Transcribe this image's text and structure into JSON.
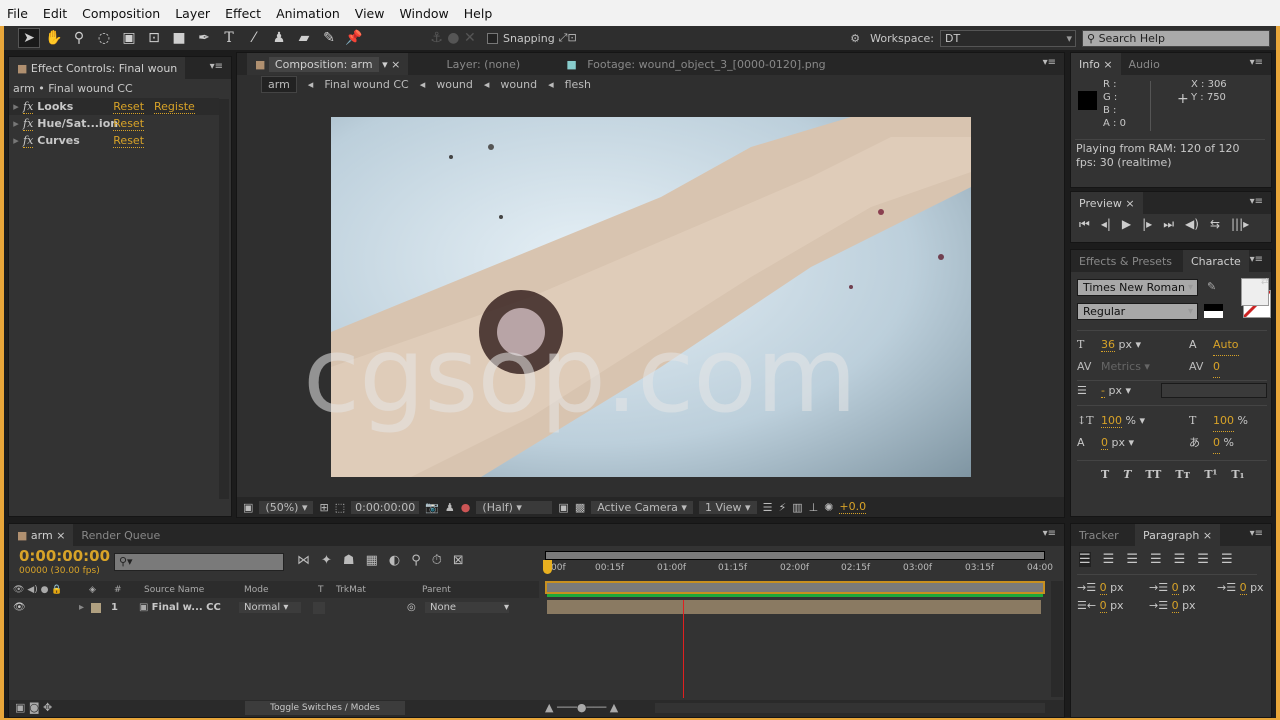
{
  "menu": [
    "File",
    "Edit",
    "Composition",
    "Layer",
    "Effect",
    "Animation",
    "View",
    "Window",
    "Help"
  ],
  "toolbar": {
    "tools": [
      "selection-tool",
      "hand-tool",
      "zoom-tool",
      "rotate-tool",
      "camera-tool",
      "pan-behind-tool",
      "rectangle-tool",
      "pen-tool",
      "type-tool",
      "brush-tool",
      "clone-stamp-tool",
      "eraser-tool",
      "roto-brush-tool",
      "puppet-pin-tool"
    ],
    "snapping_label": "Snapping",
    "workspace_label": "Workspace:",
    "workspace_value": "DT",
    "search_placeholder": "Search Help"
  },
  "effect_controls": {
    "tab": "Effect Controls: Final woun",
    "breadcrumb": "arm • Final wound CC",
    "effects": [
      {
        "name": "Looks",
        "reset": "Reset",
        "extra": "Registe"
      },
      {
        "name": "Hue/Sat...ion",
        "reset": "Reset"
      },
      {
        "name": "Curves",
        "reset": "Reset"
      }
    ],
    "fx_label": "fx"
  },
  "composition": {
    "tabs": [
      "Composition: arm",
      "Layer: (none)",
      "Footage: wound_object_3_[0000-0120].png"
    ],
    "flow": [
      "arm",
      "Final wound CC",
      "wound",
      "wound",
      "flesh"
    ],
    "watermark": "cgsop.com",
    "footer": {
      "zoom": "(50%)",
      "timecode": "0:00:00:00",
      "resolution": "(Half)",
      "camera": "Active Camera",
      "views": "1 View",
      "exposure": "+0.0"
    }
  },
  "info": {
    "tabs": [
      "Info",
      "Audio"
    ],
    "r": "R :",
    "g": "G :",
    "b": "B :",
    "a": "A : 0",
    "x": "X : 306",
    "y": "Y : 750",
    "status1": "Playing from RAM: 120 of 120",
    "status2": "fps: 30 (realtime)"
  },
  "preview": {
    "tab": "Preview",
    "controls": [
      "first-frame",
      "prev-frame",
      "play",
      "next-frame",
      "last-frame",
      "audio",
      "loop",
      "ram-preview"
    ]
  },
  "character": {
    "tabs": [
      "Effects & Presets",
      "Characte"
    ],
    "font": "Times New Roman",
    "style": "Regular",
    "size": "36",
    "size_unit": "px",
    "leading": "Auto",
    "kerning": "Metrics",
    "tracking": "0",
    "stroke": "-",
    "stroke_unit": "px",
    "vscale": "100",
    "vscale_unit": "%",
    "hscale": "100",
    "hscale_unit": "%",
    "baseline": "0",
    "baseline_unit": "px",
    "tsume": "0",
    "tsume_unit": "%",
    "styles": [
      "T",
      "T",
      "TT",
      "Tт",
      "T¹",
      "T₁"
    ]
  },
  "paragraph": {
    "tabs": [
      "Tracker",
      "Paragraph"
    ],
    "values": [
      "0",
      "0",
      "0",
      "0",
      "0"
    ],
    "unit": "px"
  },
  "timeline": {
    "tabs": [
      "arm",
      "Render Queue"
    ],
    "timecode": "0:00:00:00",
    "frames": "00000 (30.00 fps)",
    "search_placeholder": "",
    "ruler": [
      "00f",
      "00:15f",
      "01:00f",
      "01:15f",
      "02:00f",
      "02:15f",
      "03:00f",
      "03:15f",
      "04:00"
    ],
    "columns": {
      "num": "#",
      "source": "Source Name",
      "mode": "Mode",
      "t": "T",
      "trkmat": "TrkMat",
      "parent": "Parent"
    },
    "layers": [
      {
        "num": "1",
        "name": "Final w... CC",
        "mode": "Normal",
        "parent": "None"
      }
    ],
    "toggle": "Toggle Switches / Modes"
  },
  "colors": {
    "accent": "#d8a328",
    "panel": "#333333",
    "layer_bar": "#8a7a62",
    "work_area": "#1fa83a",
    "playhead": "#e02020"
  }
}
